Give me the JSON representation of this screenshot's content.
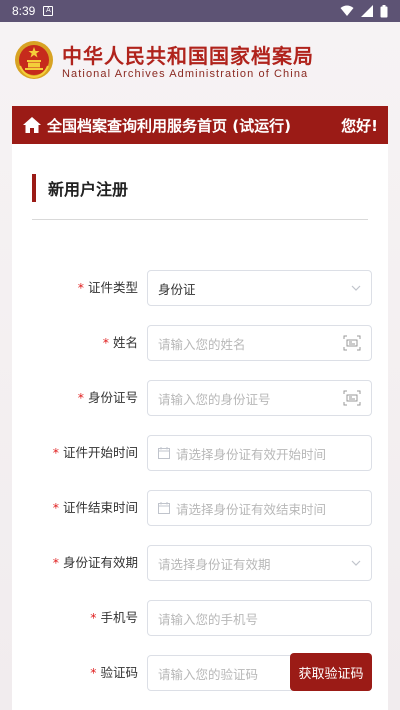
{
  "statusbar": {
    "time": "8:39",
    "notif": "A"
  },
  "header": {
    "title_cn": "中华人民共和国国家档案局",
    "title_en": "National Archives Administration of China"
  },
  "banner": {
    "title": "全国档案查询利用服务首页 (试运行)",
    "greeting": "您好!"
  },
  "form": {
    "section_title": "新用户注册",
    "fields": [
      {
        "label": "证件类型",
        "value": "身份证",
        "type": "select"
      },
      {
        "label": "姓名",
        "placeholder": "请输入您的姓名",
        "type": "text-scan"
      },
      {
        "label": "身份证号",
        "placeholder": "请输入您的身份证号",
        "type": "text-scan"
      },
      {
        "label": "证件开始时间",
        "placeholder": "请选择身份证有效开始时间",
        "type": "date"
      },
      {
        "label": "证件结束时间",
        "placeholder": "请选择身份证有效结束时间",
        "type": "date"
      },
      {
        "label": "身份证有效期",
        "placeholder": "请选择身份证有效期",
        "type": "select"
      },
      {
        "label": "手机号",
        "placeholder": "请输入您的手机号",
        "type": "text"
      },
      {
        "label": "验证码",
        "placeholder": "请输入您的验证码",
        "type": "text"
      }
    ],
    "sms_button": "获取验证码",
    "required_mark": "*"
  },
  "colors": {
    "brand": "#9b1b16",
    "required": "#e02020"
  }
}
